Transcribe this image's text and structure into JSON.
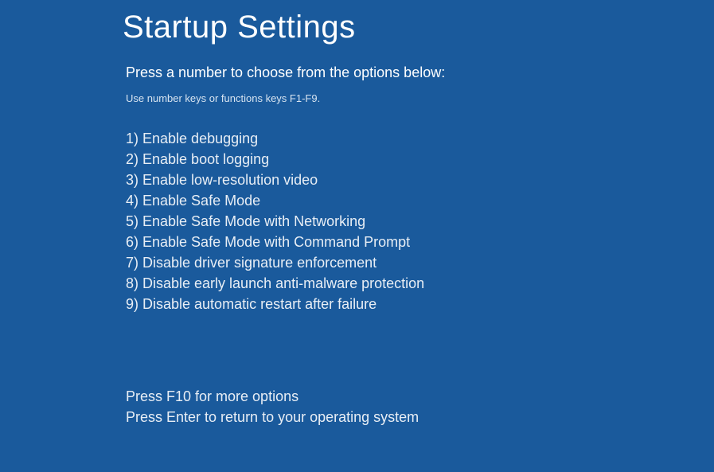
{
  "title": "Startup Settings",
  "subtitle": "Press a number to choose from the options below:",
  "hint": "Use number keys or functions keys F1-F9.",
  "options": [
    "1) Enable debugging",
    "2) Enable boot logging",
    "3) Enable low-resolution video",
    "4) Enable Safe Mode",
    "5) Enable Safe Mode with Networking",
    "6) Enable Safe Mode with Command Prompt",
    "7) Disable driver signature enforcement",
    "8) Disable early launch anti-malware protection",
    "9) Disable automatic restart after failure"
  ],
  "footer": {
    "more_options": "Press F10 for more options",
    "return": "Press Enter to return to your operating system"
  }
}
